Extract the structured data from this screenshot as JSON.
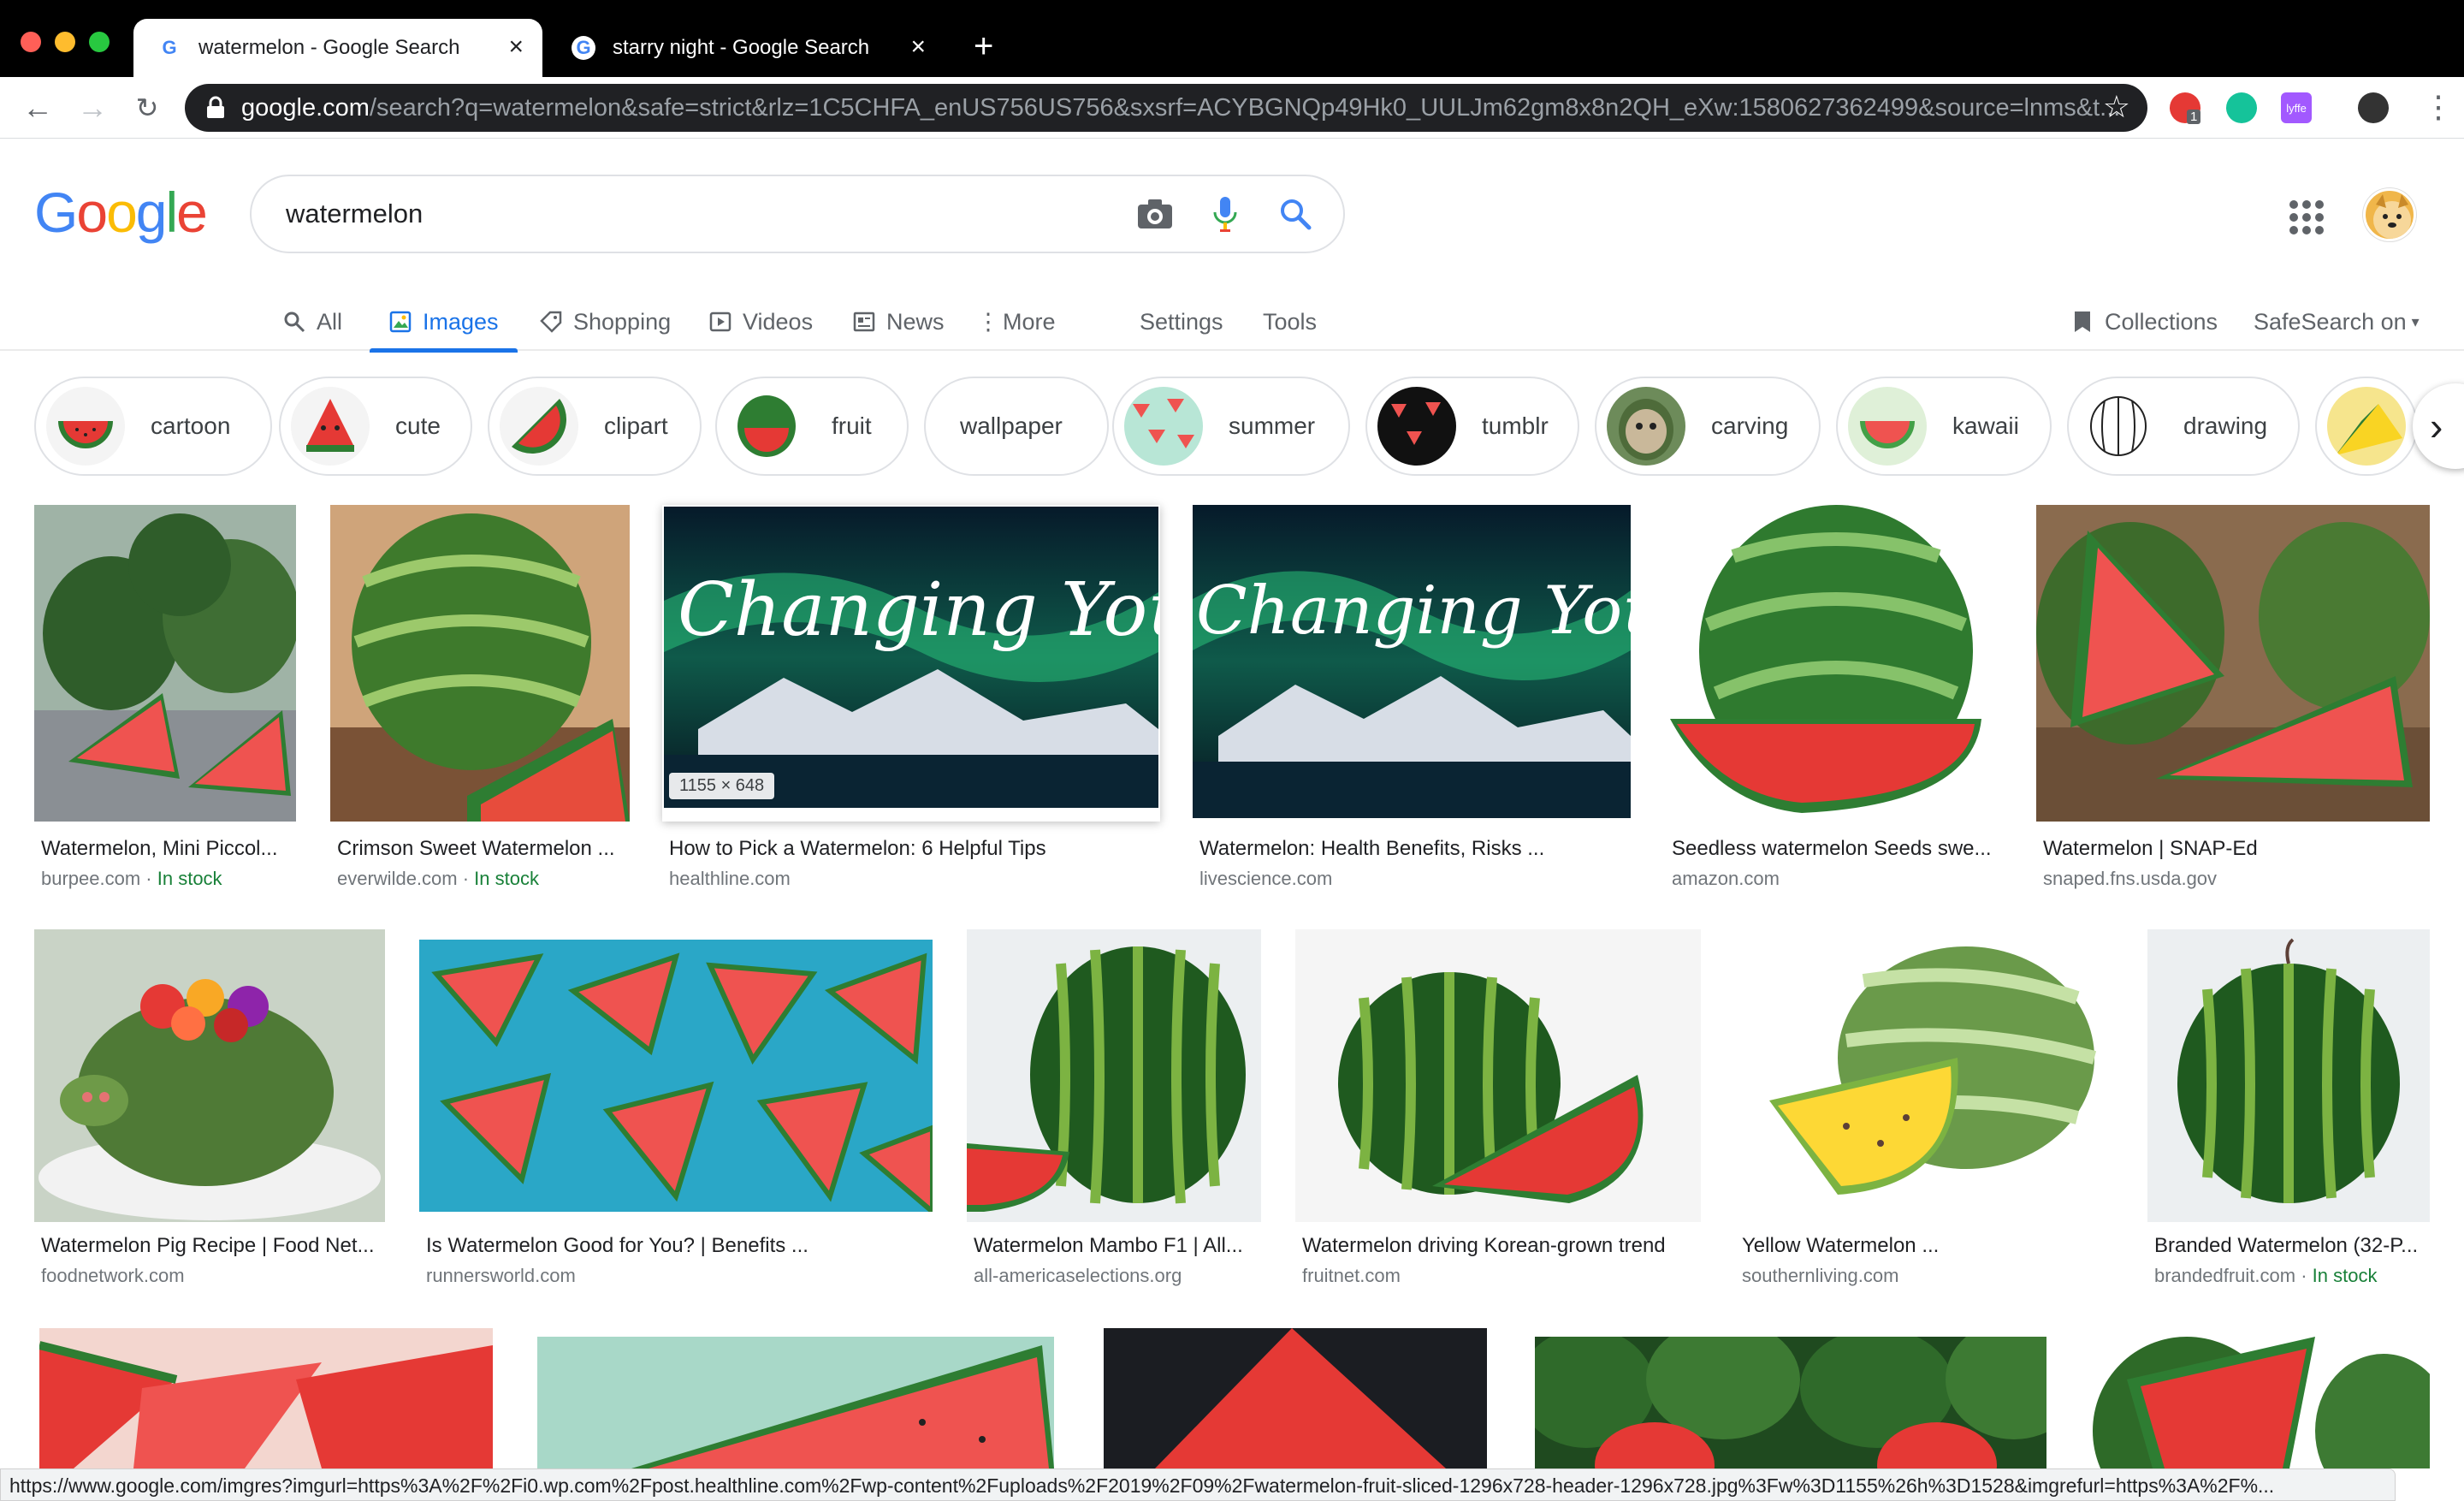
{
  "browser": {
    "tabs": [
      {
        "title": "watermelon - Google Search",
        "active": true
      },
      {
        "title": "starry night - Google Search",
        "active": false
      }
    ],
    "url_host": "google.com",
    "url_path": "/search?q=watermelon&safe=strict&rlz=1C5CHFA_enUS756US756&sxsrf=ACYBGNQp49Hk0_UULJm62gm8x8n2QH_eXw:1580627362499&source=lnms&t...",
    "extension_badge": "1",
    "extension_label": "lyffe"
  },
  "search": {
    "logo": "Google",
    "query": "watermelon"
  },
  "nav_tabs": [
    {
      "label": "All",
      "icon": "search-icon"
    },
    {
      "label": "Images",
      "icon": "image-icon",
      "active": true
    },
    {
      "label": "Shopping",
      "icon": "tag-icon"
    },
    {
      "label": "Videos",
      "icon": "play-icon"
    },
    {
      "label": "News",
      "icon": "newspaper-icon"
    },
    {
      "label": "More",
      "icon": "more-vert-icon"
    },
    {
      "label": "Settings"
    },
    {
      "label": "Tools"
    }
  ],
  "collections_label": "Collections",
  "safesearch_label": "SafeSearch on",
  "chips": [
    "cartoon",
    "cute",
    "clipart",
    "fruit",
    "wallpaper",
    "summer",
    "tumblr",
    "carving",
    "kawaii",
    "drawing"
  ],
  "results": [
    {
      "title": "Watermelon, Mini Piccol...",
      "source": "burpee.com",
      "stock": "In stock"
    },
    {
      "title": "Crimson Sweet Watermelon ...",
      "source": "everwilde.com",
      "stock": "In stock"
    },
    {
      "title": "How to Pick a Watermelon: 6 Helpful Tips",
      "source": "healthline.com",
      "dims": "1155 × 648",
      "overlay_text": "Changing Your Lyffe"
    },
    {
      "title": "Watermelon: Health Benefits, Risks ...",
      "source": "livescience.com",
      "overlay_text": "Changing Your Lyffe"
    },
    {
      "title": "Seedless watermelon Seeds swe...",
      "source": "amazon.com"
    },
    {
      "title": "Watermelon | SNAP-Ed",
      "source": "snaped.fns.usda.gov"
    },
    {
      "title": "Watermelon Pig Recipe | Food Net...",
      "source": "foodnetwork.com"
    },
    {
      "title": "Is Watermelon Good for You? | Benefits ...",
      "source": "runnersworld.com"
    },
    {
      "title": "Watermelon Mambo F1 | All...",
      "source": "all-americaselections.org"
    },
    {
      "title": "Watermelon driving Korean-grown trend",
      "source": "fruitnet.com"
    },
    {
      "title": "Yellow Watermelon ...",
      "source": "southernliving.com"
    },
    {
      "title": "Branded Watermelon (32-P...",
      "source": "brandedfruit.com",
      "stock": "In stock"
    }
  ],
  "status_url": "https://www.google.com/imgres?imgurl=https%3A%2F%2Fi0.wp.com%2Fpost.healthline.com%2Fwp-content%2Fuploads%2F2019%2F09%2Fwatermelon-fruit-sliced-1296x728-header-1296x728.jpg%3Fw%3D1155%26h%3D1528&imgrefurl=https%3A%2F%..."
}
